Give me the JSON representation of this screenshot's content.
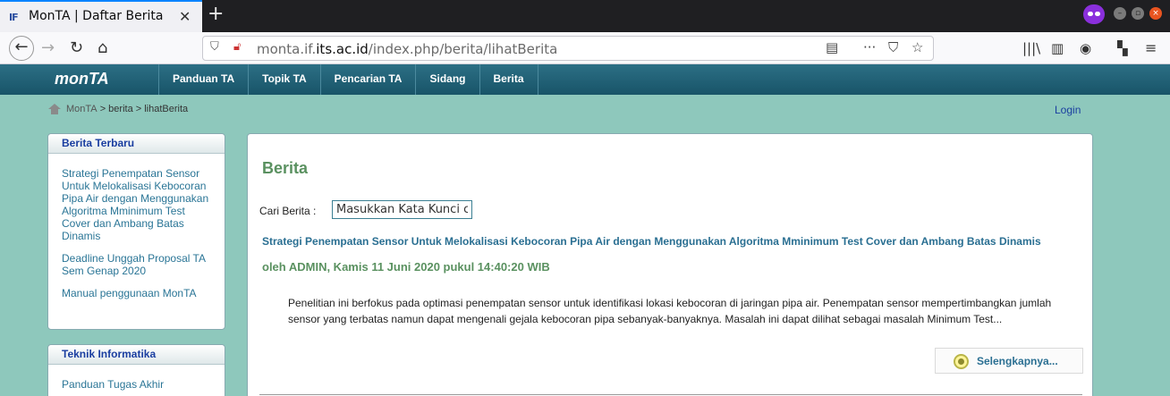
{
  "browser": {
    "tab_title": "MonTA | Daftar Berita",
    "favicon_text": "IF",
    "url_host_prefix": "monta.if.",
    "url_host_bold": "its.ac.id",
    "url_path": "/index.php/berita/lihatBerita"
  },
  "site": {
    "logo": "monTA",
    "menu": [
      "Panduan TA",
      "Topik TA",
      "Pencarian TA",
      "Sidang",
      "Berita"
    ],
    "breadcrumb": {
      "home": "MonTA",
      "rest": " > berita > lihatBerita"
    },
    "login": "Login"
  },
  "sidebar": {
    "recent": {
      "title": "Berita Terbaru",
      "items": [
        "Strategi Penempatan Sensor Untuk Melokalisasi Kebocoran Pipa Air dengan Menggunakan Algoritma Mminimum Test Cover dan Ambang Batas Dinamis",
        "Deadline Unggah Proposal TA Sem Genap 2020",
        "Manual penggunaan MonTA"
      ]
    },
    "dept": {
      "title": "Teknik Informatika",
      "items": [
        "Panduan Tugas Akhir"
      ]
    }
  },
  "main": {
    "title": "Berita",
    "search_label": "Cari Berita :",
    "search_value": "Masukkan Kata Kunci c",
    "news": [
      {
        "title": "Strategi Penempatan Sensor Untuk Melokalisasi Kebocoran Pipa Air dengan Menggunakan Algoritma Mminimum Test Cover dan Ambang Batas Dinamis",
        "meta": "oleh ADMIN, Kamis 11 Juni 2020 pukul 14:40:20 WIB",
        "body": "Penelitian ini berfokus pada optimasi penempatan sensor untuk identifikasi lokasi kebocoran di jaringan pipa air. Penempatan sensor mempertimbangkan jumlah sensor yang terbatas namun dapat mengenali gejala kebocoran pipa sebanyak-banyaknya. Masalah ini dapat dilihat sebagai masalah Minimum Test...",
        "more": "Selengkapnya..."
      }
    ]
  },
  "colors": {
    "page_bg": "#8ec8bc",
    "header_bg": "#1f5a6e",
    "title_green": "#5a9160",
    "link_blue": "#2a6f92"
  },
  "icons": [
    "favicon-if",
    "close-icon",
    "plus-icon",
    "private-mask-icon",
    "back-arrow-icon",
    "forward-arrow-icon",
    "reload-icon",
    "home-icon",
    "shield-icon",
    "insecure-lock-icon",
    "reader-view-icon",
    "more-dots-icon",
    "pocket-icon",
    "star-icon",
    "library-icon",
    "sidebar-icon",
    "account-icon",
    "extensions-icon",
    "hamburger-menu-icon",
    "eye-icon"
  ]
}
